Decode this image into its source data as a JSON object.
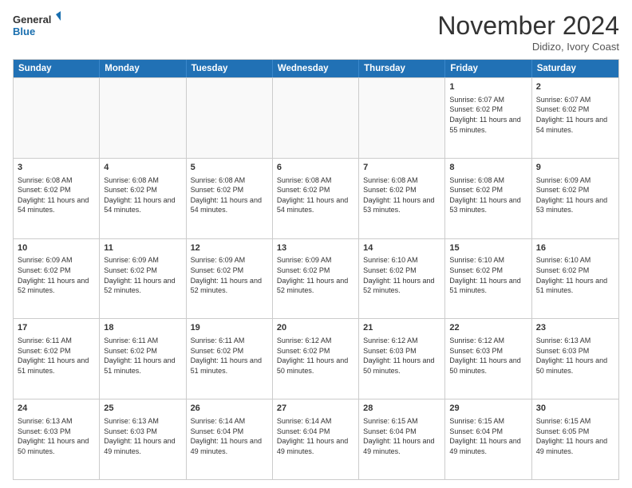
{
  "header": {
    "logo_line1": "General",
    "logo_line2": "Blue",
    "month_title": "November 2024",
    "subtitle": "Didizo, Ivory Coast"
  },
  "days_of_week": [
    "Sunday",
    "Monday",
    "Tuesday",
    "Wednesday",
    "Thursday",
    "Friday",
    "Saturday"
  ],
  "weeks": [
    [
      {
        "day": "",
        "info": "",
        "empty": true
      },
      {
        "day": "",
        "info": "",
        "empty": true
      },
      {
        "day": "",
        "info": "",
        "empty": true
      },
      {
        "day": "",
        "info": "",
        "empty": true
      },
      {
        "day": "",
        "info": "",
        "empty": true
      },
      {
        "day": "1",
        "info": "Sunrise: 6:07 AM\nSunset: 6:02 PM\nDaylight: 11 hours and 55 minutes.",
        "empty": false
      },
      {
        "day": "2",
        "info": "Sunrise: 6:07 AM\nSunset: 6:02 PM\nDaylight: 11 hours and 54 minutes.",
        "empty": false
      }
    ],
    [
      {
        "day": "3",
        "info": "Sunrise: 6:08 AM\nSunset: 6:02 PM\nDaylight: 11 hours and 54 minutes.",
        "empty": false
      },
      {
        "day": "4",
        "info": "Sunrise: 6:08 AM\nSunset: 6:02 PM\nDaylight: 11 hours and 54 minutes.",
        "empty": false
      },
      {
        "day": "5",
        "info": "Sunrise: 6:08 AM\nSunset: 6:02 PM\nDaylight: 11 hours and 54 minutes.",
        "empty": false
      },
      {
        "day": "6",
        "info": "Sunrise: 6:08 AM\nSunset: 6:02 PM\nDaylight: 11 hours and 54 minutes.",
        "empty": false
      },
      {
        "day": "7",
        "info": "Sunrise: 6:08 AM\nSunset: 6:02 PM\nDaylight: 11 hours and 53 minutes.",
        "empty": false
      },
      {
        "day": "8",
        "info": "Sunrise: 6:08 AM\nSunset: 6:02 PM\nDaylight: 11 hours and 53 minutes.",
        "empty": false
      },
      {
        "day": "9",
        "info": "Sunrise: 6:09 AM\nSunset: 6:02 PM\nDaylight: 11 hours and 53 minutes.",
        "empty": false
      }
    ],
    [
      {
        "day": "10",
        "info": "Sunrise: 6:09 AM\nSunset: 6:02 PM\nDaylight: 11 hours and 52 minutes.",
        "empty": false
      },
      {
        "day": "11",
        "info": "Sunrise: 6:09 AM\nSunset: 6:02 PM\nDaylight: 11 hours and 52 minutes.",
        "empty": false
      },
      {
        "day": "12",
        "info": "Sunrise: 6:09 AM\nSunset: 6:02 PM\nDaylight: 11 hours and 52 minutes.",
        "empty": false
      },
      {
        "day": "13",
        "info": "Sunrise: 6:09 AM\nSunset: 6:02 PM\nDaylight: 11 hours and 52 minutes.",
        "empty": false
      },
      {
        "day": "14",
        "info": "Sunrise: 6:10 AM\nSunset: 6:02 PM\nDaylight: 11 hours and 52 minutes.",
        "empty": false
      },
      {
        "day": "15",
        "info": "Sunrise: 6:10 AM\nSunset: 6:02 PM\nDaylight: 11 hours and 51 minutes.",
        "empty": false
      },
      {
        "day": "16",
        "info": "Sunrise: 6:10 AM\nSunset: 6:02 PM\nDaylight: 11 hours and 51 minutes.",
        "empty": false
      }
    ],
    [
      {
        "day": "17",
        "info": "Sunrise: 6:11 AM\nSunset: 6:02 PM\nDaylight: 11 hours and 51 minutes.",
        "empty": false
      },
      {
        "day": "18",
        "info": "Sunrise: 6:11 AM\nSunset: 6:02 PM\nDaylight: 11 hours and 51 minutes.",
        "empty": false
      },
      {
        "day": "19",
        "info": "Sunrise: 6:11 AM\nSunset: 6:02 PM\nDaylight: 11 hours and 51 minutes.",
        "empty": false
      },
      {
        "day": "20",
        "info": "Sunrise: 6:12 AM\nSunset: 6:02 PM\nDaylight: 11 hours and 50 minutes.",
        "empty": false
      },
      {
        "day": "21",
        "info": "Sunrise: 6:12 AM\nSunset: 6:03 PM\nDaylight: 11 hours and 50 minutes.",
        "empty": false
      },
      {
        "day": "22",
        "info": "Sunrise: 6:12 AM\nSunset: 6:03 PM\nDaylight: 11 hours and 50 minutes.",
        "empty": false
      },
      {
        "day": "23",
        "info": "Sunrise: 6:13 AM\nSunset: 6:03 PM\nDaylight: 11 hours and 50 minutes.",
        "empty": false
      }
    ],
    [
      {
        "day": "24",
        "info": "Sunrise: 6:13 AM\nSunset: 6:03 PM\nDaylight: 11 hours and 50 minutes.",
        "empty": false
      },
      {
        "day": "25",
        "info": "Sunrise: 6:13 AM\nSunset: 6:03 PM\nDaylight: 11 hours and 49 minutes.",
        "empty": false
      },
      {
        "day": "26",
        "info": "Sunrise: 6:14 AM\nSunset: 6:04 PM\nDaylight: 11 hours and 49 minutes.",
        "empty": false
      },
      {
        "day": "27",
        "info": "Sunrise: 6:14 AM\nSunset: 6:04 PM\nDaylight: 11 hours and 49 minutes.",
        "empty": false
      },
      {
        "day": "28",
        "info": "Sunrise: 6:15 AM\nSunset: 6:04 PM\nDaylight: 11 hours and 49 minutes.",
        "empty": false
      },
      {
        "day": "29",
        "info": "Sunrise: 6:15 AM\nSunset: 6:04 PM\nDaylight: 11 hours and 49 minutes.",
        "empty": false
      },
      {
        "day": "30",
        "info": "Sunrise: 6:15 AM\nSunset: 6:05 PM\nDaylight: 11 hours and 49 minutes.",
        "empty": false
      }
    ]
  ]
}
